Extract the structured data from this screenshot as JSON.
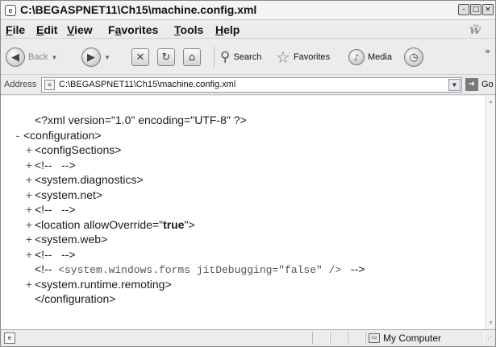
{
  "window": {
    "title": "C:\\BEGASPNET11\\Ch15\\machine.config.xml",
    "controls": {
      "minimize": "–",
      "maximize": "□",
      "close": "×"
    }
  },
  "menu": {
    "items": [
      {
        "label": "File",
        "accel": "F",
        "rest": "ile"
      },
      {
        "label": "Edit",
        "accel": "E",
        "rest": "dit"
      },
      {
        "label": "View",
        "accel": "V",
        "rest": "iew"
      },
      {
        "label": "Favorites",
        "pre": "F",
        "accel": "a",
        "rest": "vorites"
      },
      {
        "label": "Tools",
        "accel": "T",
        "rest": "ools"
      },
      {
        "label": "Help",
        "accel": "H",
        "rest": "elp"
      }
    ]
  },
  "toolbar": {
    "back_label": "Back",
    "search_label": "Search",
    "favorites_label": "Favorites",
    "media_label": "Media",
    "chevron": "»"
  },
  "address": {
    "label": "Address",
    "value": "C:\\BEGASPNET11\\Ch15\\machine.config.xml",
    "go_label": "Go"
  },
  "xml_lines": [
    {
      "sign": "",
      "text": "<?xml version=\"1.0\" encoding=\"UTF-8\" ?>"
    },
    {
      "sign": "-",
      "text": "<configuration>"
    },
    {
      "sign": "+",
      "text": "<configSections>"
    },
    {
      "sign": "+",
      "text": "<!--   -->"
    },
    {
      "sign": "+",
      "text": "<system.diagnostics>"
    },
    {
      "sign": "+",
      "text": "<system.net>"
    },
    {
      "sign": "+",
      "text": "<!--   -->"
    },
    {
      "sign": "+",
      "pre": "<location allowOverride=\"",
      "bold": "true",
      "post": "\">"
    },
    {
      "sign": "+",
      "text": "<system.web>"
    },
    {
      "sign": "+",
      "text": "<!--   -->"
    },
    {
      "sign": "",
      "pre": "<!--  ",
      "mono": "<system.windows.forms jitDebugging=\"false\" />",
      "post": "   -->"
    },
    {
      "sign": "+",
      "text": "<system.runtime.remoting>"
    },
    {
      "sign": "",
      "text": "</configuration>"
    }
  ],
  "status": {
    "zone_label": "My Computer"
  },
  "colors": {
    "chrome": "#ececec",
    "address_border": "#7f9db9"
  }
}
